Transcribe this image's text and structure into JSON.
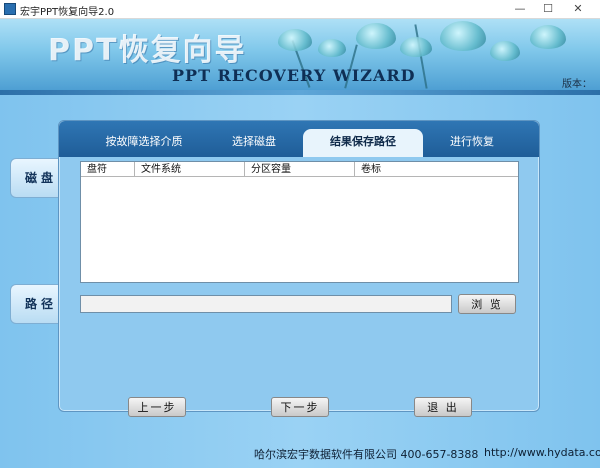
{
  "window": {
    "title": "宏宇PPT恢复向导2.0",
    "minimize_icon": "minimize-icon",
    "maximize_icon": "maximize-icon",
    "close_icon": "close-icon"
  },
  "banner": {
    "title_cn": "PPT恢复向导",
    "title_en": "PPT RECOVERY WIZARD",
    "version_label": "版本："
  },
  "side_tabs": {
    "disk": "磁盘",
    "path": "路径"
  },
  "tabs": [
    {
      "label": "按故障选择介质",
      "active": false
    },
    {
      "label": "选择磁盘",
      "active": false
    },
    {
      "label": "结果保存路径",
      "active": true
    },
    {
      "label": "进行恢复",
      "active": false
    }
  ],
  "disk_list": {
    "columns": [
      "盘符",
      "文件系统",
      "分区容量",
      "卷标"
    ]
  },
  "path": {
    "value": "",
    "browse_label": "浏 览"
  },
  "buttons": {
    "prev": "上一步",
    "next": "下一步",
    "exit": "退 出"
  },
  "footer": {
    "company": "哈尔滨宏宇数据软件有限公司  400-657-8388",
    "url": "http://www.hydata.com"
  },
  "colors": {
    "accent": "#1f5d98",
    "panel": "#8fc9ef",
    "background": "#9ad2f4"
  }
}
